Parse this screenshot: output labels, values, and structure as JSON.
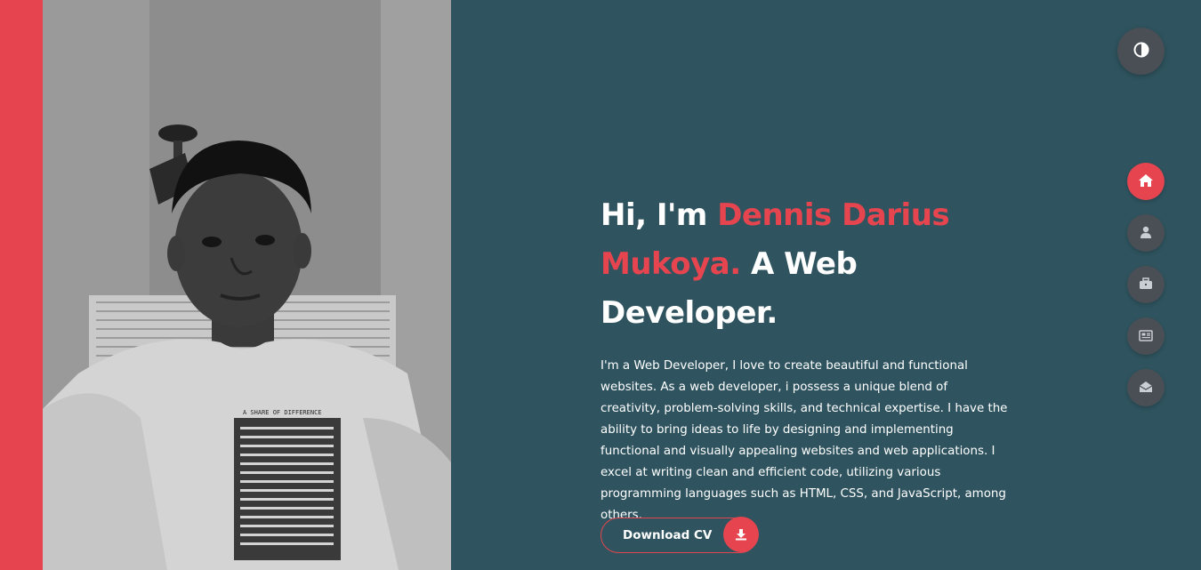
{
  "hero": {
    "greeting": "Hi, I'm ",
    "name": "Dennis Darius Mukoya.",
    "role": " A Web Developer.",
    "bio": "I'm a Web Developer, I love to create beautiful and functional websites. As a web developer, i possess a unique blend of creativity, problem-solving skills, and technical expertise. I have the ability to bring ideas to life by designing and implementing functional and visually appealing websites and web applications. I excel at writing clean and efficient code, utilizing various programming languages such as HTML, CSS, and JavaScript, among others.",
    "cta_label": "Download CV"
  },
  "photo": {
    "shirt_text_1": "A SHARE OF DIFFERENCE",
    "shirt_text_2": "A SHARE OF DIFFERENCE"
  },
  "colors": {
    "accent": "#e6454f",
    "background": "#2f545f",
    "button_dark": "#4a4f56"
  },
  "icons": {
    "theme_toggle": "contrast-icon",
    "download": "download-icon",
    "nav": [
      "home-icon",
      "user-icon",
      "briefcase-icon",
      "newspaper-icon",
      "envelope-open-icon"
    ]
  }
}
